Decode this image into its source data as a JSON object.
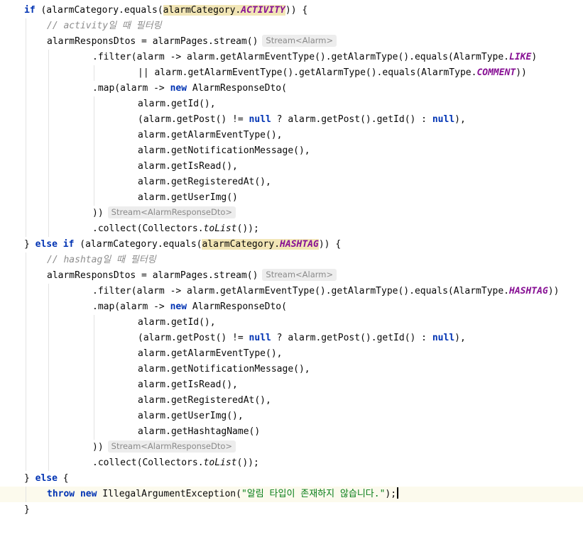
{
  "editor": {
    "tokens": {
      "kw_if": "if",
      "kw_else": "else",
      "kw_new": "new",
      "kw_null": "null",
      "kw_throw": "throw",
      "alarm_category": "alarmCategory",
      "activity": "ACTIVITY",
      "hashtag": "HASHTAG",
      "like": "LIKE",
      "comment_const": "COMMENT",
      "to_list": "toList"
    },
    "lines": {
      "l1_a": " (alarmCategory.equals(",
      "l1_b": ".",
      "l1_c": ")) {",
      "l2": "// activity일 때 필터링",
      "l3": "alarmResponsDtos = alarmPages.stream()",
      "l3_hint": "Stream<Alarm>",
      "l4_a": ".filter(alarm -> alarm.getAlarmEventType().getAlarmType().equals(AlarmType.",
      "l4_b": ")",
      "l5_a": "|| alarm.getAlarmEventType().getAlarmType().equals(AlarmType.",
      "l5_b": "))",
      "l6_a": ".map(alarm -> ",
      "l6_b": " AlarmResponseDto(",
      "l7": "alarm.getId(),",
      "l8_a": "(alarm.getPost() != ",
      "l8_b": " ? alarm.getPost().getId() : ",
      "l8_c": "),",
      "l9": "alarm.getAlarmEventType(),",
      "l10": "alarm.getNotificationMessage(),",
      "l11": "alarm.getIsRead(),",
      "l12": "alarm.getRegisteredAt(),",
      "l13": "alarm.getUserImg()",
      "l14": "))",
      "l14_hint": "Stream<AlarmResponseDto>",
      "l15_a": ".collect(Collectors.",
      "l15_b": "());",
      "l16_a": "} ",
      "l16_b": " (alarmCategory.equals(",
      "l16_c": ".",
      "l16_d": ")) {",
      "l17": "// hashtag일 때 필터링",
      "l18": "alarmResponsDtos = alarmPages.stream()",
      "l18_hint": "Stream<Alarm>",
      "l19_a": ".filter(alarm -> alarm.getAlarmEventType().getAlarmType().equals(AlarmType.",
      "l19_b": "))",
      "l20_a": ".map(alarm -> ",
      "l20_b": " AlarmResponseDto(",
      "l21": "alarm.getId(),",
      "l22_a": "(alarm.getPost() != ",
      "l22_b": " ? alarm.getPost().getId() : ",
      "l22_c": "),",
      "l23": "alarm.getAlarmEventType(),",
      "l24": "alarm.getNotificationMessage(),",
      "l25": "alarm.getIsRead(),",
      "l26": "alarm.getRegisteredAt(),",
      "l27": "alarm.getUserImg(),",
      "l28": "alarm.getHashtagName()",
      "l29": "))",
      "l29_hint": "Stream<AlarmResponseDto>",
      "l30_a": ".collect(Collectors.",
      "l30_b": "());",
      "l31_a": "} ",
      "l31_b": " {",
      "l32_a": " ",
      "l32_b": " IllegalArgumentException(",
      "l32_str": "\"알림 타입이 존재하지 않습니다.\"",
      "l32_c": ");",
      "l33": "}"
    }
  },
  "colors": {
    "keyword": "#0033b3",
    "constant": "#871094",
    "comment": "#8c8c8c",
    "string": "#067d17",
    "highlight": "#f2e6b6",
    "current_line": "#fcfaed"
  }
}
